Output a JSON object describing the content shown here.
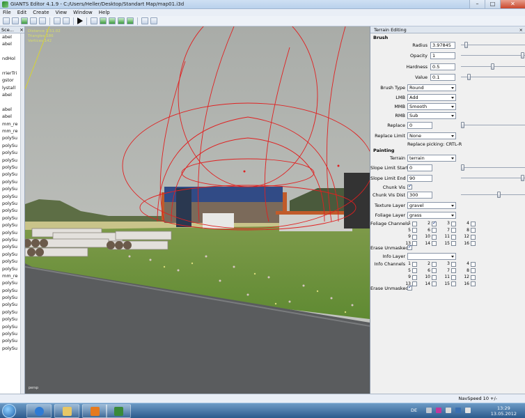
{
  "window": {
    "title": "GIANTS Editor 4.1.9 - C:/Users/Heller/Desktop/Standart Map/map01.i3d",
    "minimize": "–",
    "maximize": "□",
    "close": "✕"
  },
  "menu": [
    "File",
    "Edit",
    "Create",
    "View",
    "Window",
    "Help"
  ],
  "toolbar": {
    "icons": [
      "new-file-icon",
      "open-file-icon",
      "save-icon",
      "reload-icon",
      "save-as-icon",
      "undo-icon",
      "redo-icon",
      "play-icon",
      "select-icon",
      "terrain-raise-icon",
      "terrain-paint-icon",
      "foliage-icon",
      "texture-icon",
      "settings-icon",
      "navigation-icon"
    ]
  },
  "scenegraph": {
    "title": "Sce...",
    "close": "×",
    "items": [
      "abel",
      "abel",
      "",
      "ndHol",
      "",
      "rrierTri",
      "gstor",
      "lystall",
      "abel",
      "",
      "abel",
      "abel",
      "mm_re",
      "mm_re",
      "polySu",
      "polySu",
      "polySu",
      "polySu",
      "polySu",
      "polySu",
      "polySu",
      "polySu",
      "polySu",
      "polySu",
      "polySu",
      "polySu",
      "polySu",
      "polySu",
      "polySu",
      "polySu",
      "polySu",
      "polySu",
      "polySu",
      "mm_re",
      "polySu",
      "polySu",
      "polySu",
      "polySu",
      "polySu",
      "polySu",
      "polySu",
      "polySu",
      "polySu",
      "polySu"
    ]
  },
  "viewport": {
    "stats": [
      "Distance 1.51.02",
      "Triangles 186",
      "Vertices 142"
    ],
    "corner": "persp"
  },
  "panel": {
    "title": "Terrain Editing",
    "close": "×",
    "brush_section": "Brush",
    "radius_label": "Radius",
    "radius_value": "3.97845",
    "radius_level": 0.06,
    "opacity_label": "Opacity",
    "opacity_value": "1",
    "opacity_level": 1.0,
    "hardness_label": "Hardness",
    "hardness_value": "0.5",
    "hardness_level": 0.5,
    "value_label": "Value",
    "value_value": "0.1",
    "value_level": 0.1,
    "brush_type_label": "Brush Type",
    "brush_type_value": "Round",
    "lmb_label": "LMB",
    "lmb_value": "Add",
    "mmb_label": "MMB",
    "mmb_value": "Smooth",
    "rmb_label": "RMB",
    "rmb_value": "Sub",
    "replace_label": "Replace",
    "replace_value": "0",
    "replace_level": 0.0,
    "replace_limit_label": "Replace Limit",
    "replace_limit_value": "None",
    "replace_picking": "Replace picking: CRTL-R",
    "painting_section": "Painting",
    "terrain_label": "Terrain",
    "terrain_value": "terrain",
    "slope_start_label": "Slope Limit Start",
    "slope_start_value": "0",
    "slope_start_level": 0.0,
    "slope_end_label": "Slope Limit End",
    "slope_end_value": "90",
    "slope_end_level": 1.0,
    "chunk_vis_label": "Chunk Vis",
    "chunk_vis_checked": true,
    "chunk_vis_dist_label": "Chunk Vis Dist",
    "chunk_vis_dist_value": "300",
    "chunk_vis_dist_level": 0.6,
    "texture_layer_label": "Texture Layer",
    "texture_layer_value": "gravel",
    "foliage_layer_label": "Foliage Layer",
    "foliage_layer_value": "grass",
    "foliage_channels_label": "Foliage Channels",
    "erase_unmasked_label": "Erase Unmasked",
    "info_layer_label": "Info Layer",
    "info_layer_value": "",
    "info_channels_label": "Info Channels",
    "erase_unmasked2_label": "Erase Unmasked",
    "channel_numbers": [
      "1",
      "2",
      "3",
      "4",
      "5",
      "6",
      "7",
      "8",
      "9",
      "10",
      "11",
      "12",
      "13",
      "14",
      "15",
      "16"
    ]
  },
  "statusbar": {
    "navspeed": "NavSpeed 10 +/-"
  },
  "taskbar": {
    "lang": "DE",
    "time": "13:29",
    "date": "13.05.2012"
  }
}
